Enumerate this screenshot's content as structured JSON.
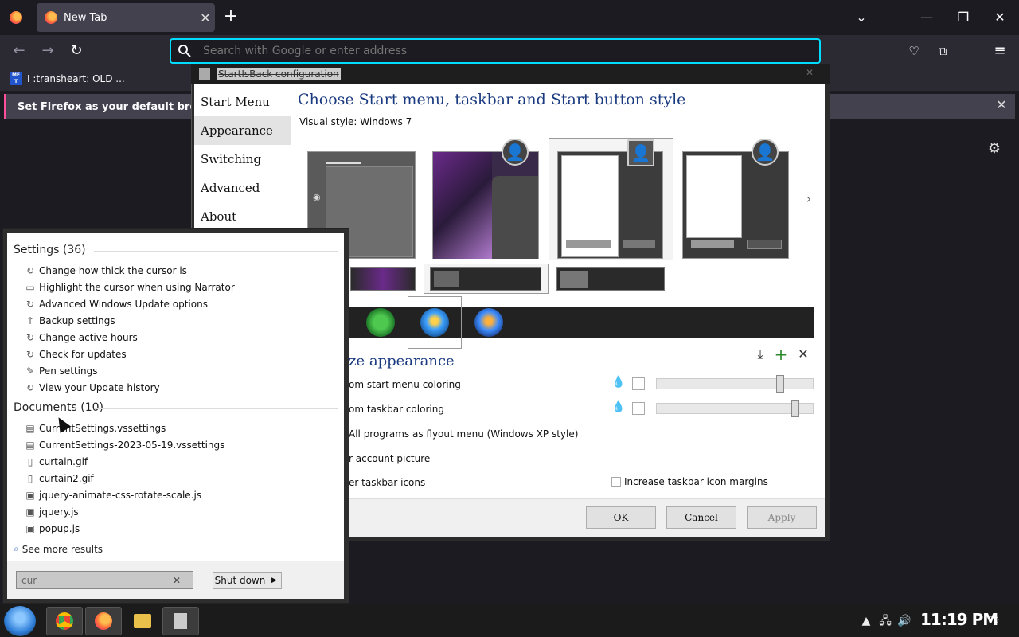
{
  "browser": {
    "tab_title": "New Tab",
    "url_placeholder": "Search with Google or enter address",
    "bookmark_label": "I :transheart: OLD ...",
    "bookmark_icon_text": "MF T",
    "notification_text": "Set Firefox as your default browser"
  },
  "sib": {
    "window_title": "StartIsBack configuration",
    "nav": [
      "Start Menu",
      "Appearance",
      "Switching",
      "Advanced",
      "About"
    ],
    "selected_nav": "Appearance",
    "heading": "Choose Start menu, taskbar and Start button style",
    "visual_style_label": "Visual style:  Windows 7",
    "customize_heading": "ze appearance",
    "options": [
      "om start menu coloring",
      "om taskbar coloring",
      "All programs as flyout menu (Windows XP style)",
      "r account picture",
      "er taskbar icons"
    ],
    "margins_label": "Increase taskbar icon margins",
    "buttons": {
      "ok": "OK",
      "cancel": "Cancel",
      "apply": "Apply"
    }
  },
  "startmenu": {
    "settings_header": "Settings (36)",
    "settings": [
      "Change how thick the cursor is",
      "Highlight the cursor when using Narrator",
      "Advanced Windows Update options",
      "Backup settings",
      "Change active hours",
      "Check for updates",
      "Pen settings",
      "View your Update history"
    ],
    "documents_header": "Documents (10)",
    "documents": [
      "CurrentSettings.vssettings",
      "CurrentSettings-2023-05-19.vssettings",
      "curtain.gif",
      "curtain2.gif",
      "jquery-animate-css-rotate-scale.js",
      "jquery.js",
      "popup.js"
    ],
    "see_more": "See more results",
    "search_value": "cur",
    "shutdown_label": "Shut down"
  },
  "taskbar": {
    "clock": "11:19 PM"
  }
}
